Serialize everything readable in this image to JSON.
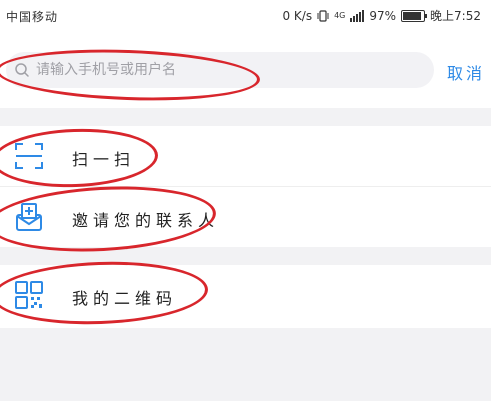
{
  "status_bar": {
    "carrier": "中国移动",
    "speed": "0 K/s",
    "network": "4G",
    "battery": "97%",
    "time": "晚上7:52"
  },
  "search": {
    "placeholder": "请输入手机号或用户名",
    "cancel_label": "取消"
  },
  "menu": {
    "items": [
      {
        "label": "扫一扫",
        "icon": "scan-icon"
      },
      {
        "label": "邀请您的联系人",
        "icon": "invite-contacts-icon"
      },
      {
        "label": "我的二维码",
        "icon": "qr-code-icon"
      }
    ]
  },
  "colors": {
    "accent": "#2e8ae6",
    "annotation": "#d8262c"
  }
}
